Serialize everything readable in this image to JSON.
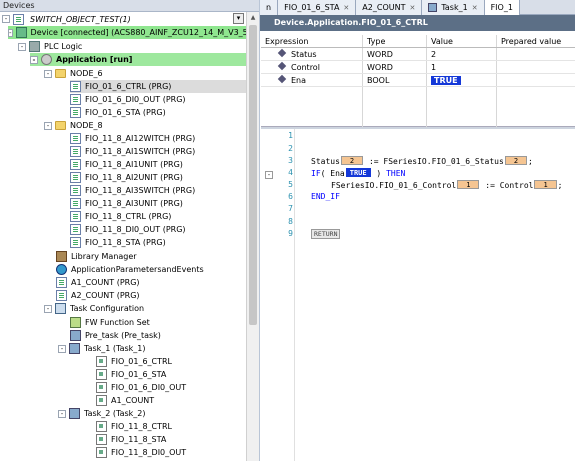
{
  "devices": {
    "title": "Devices",
    "root_label": "SWITCH_OBJECT_TEST(1)",
    "items": [
      {
        "label": "Device [connected] (ACS880_AINF_ZCU12_14_M_V3_5)"
      },
      {
        "label": "PLC Logic"
      },
      {
        "label": "Application [run]"
      },
      {
        "label": "NODE_6"
      },
      {
        "label": "FIO_01_6_CTRL (PRG)"
      },
      {
        "label": "FIO_01_6_DI0_OUT (PRG)"
      },
      {
        "label": "FIO_01_6_STA (PRG)"
      },
      {
        "label": "NODE_8"
      },
      {
        "label": "FIO_11_8_AI12WITCH (PRG)"
      },
      {
        "label": "FIO_11_8_AI1SWITCH (PRG)"
      },
      {
        "label": "FIO_11_8_AI1UNIT (PRG)"
      },
      {
        "label": "FIO_11_8_AI2UNIT (PRG)"
      },
      {
        "label": "FIO_11_8_AI3SWITCH (PRG)"
      },
      {
        "label": "FIO_11_8_AI3UNIT (PRG)"
      },
      {
        "label": "FIO_11_8_CTRL (PRG)"
      },
      {
        "label": "FIO_11_8_DI0_OUT (PRG)"
      },
      {
        "label": "FIO_11_8_STA (PRG)"
      },
      {
        "label": "Library Manager"
      },
      {
        "label": "ApplicationParametersandEvents"
      },
      {
        "label": "A1_COUNT (PRG)"
      },
      {
        "label": "A2_COUNT (PRG)"
      },
      {
        "label": "Task Configuration"
      },
      {
        "label": "FW Function Set"
      },
      {
        "label": "Pre_task (Pre_task)"
      },
      {
        "label": "Task_1 (Task_1)"
      },
      {
        "label": "FIO_01_6_CTRL"
      },
      {
        "label": "FIO_01_6_STA"
      },
      {
        "label": "FIO_01_6_DI0_OUT"
      },
      {
        "label": "A1_COUNT"
      },
      {
        "label": "Task_2 (Task_2)"
      },
      {
        "label": "FIO_11_8_CTRL"
      },
      {
        "label": "FIO_11_8_STA"
      },
      {
        "label": "FIO_11_8_DI0_OUT"
      }
    ]
  },
  "tabs": [
    {
      "label": "n"
    },
    {
      "label": "FIO_01_6_STA"
    },
    {
      "label": "A2_COUNT"
    },
    {
      "label": "Task_1"
    },
    {
      "label": "FIO_1"
    }
  ],
  "editor": {
    "title": "Device.Application.FIO_01_6_CTRL",
    "watch": {
      "headers": [
        "Expression",
        "Type",
        "Value",
        "Prepared value"
      ],
      "rows": [
        {
          "expression": "Status",
          "type": "WORD",
          "value": "2",
          "prepared": ""
        },
        {
          "expression": "Control",
          "type": "WORD",
          "value": "1",
          "prepared": ""
        },
        {
          "expression": "Ena",
          "type": "BOOL",
          "value": "TRUE",
          "prepared": ""
        }
      ]
    },
    "code": {
      "line_numbers": [
        "1",
        "2",
        "3",
        "4",
        "5",
        "6",
        "7",
        "8",
        "9"
      ],
      "line3": {
        "a": "Status",
        "m1": "2",
        "b": ":= FSeriesIO.FIO_01_6_Status",
        "m2": "2",
        "c": ";"
      },
      "line4": {
        "kw1": "IF",
        "a": "( Ena",
        "m1": "TRUE",
        "b": ")",
        "kw2": "THEN"
      },
      "line5": {
        "a": "FSeriesIO.FIO_01_6_Control",
        "m1": "1",
        "b": ":= Control",
        "m2": "1",
        "c": ";"
      },
      "line6": {
        "kw": "END_IF"
      },
      "line9": {
        "ret": "RETURN"
      }
    }
  }
}
